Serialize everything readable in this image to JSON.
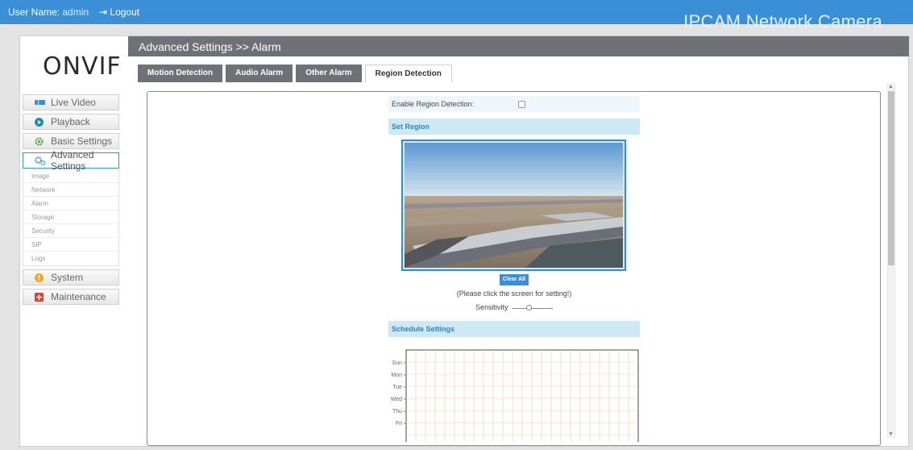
{
  "topbar": {
    "user_label": "User Name:",
    "user_value": "admin",
    "logout": "Logout",
    "brand": "IPCAM Network Camera"
  },
  "sidebar": {
    "logo": "ONVIF",
    "items": [
      {
        "label": "Live Video",
        "icon": "live-video-icon"
      },
      {
        "label": "Playback",
        "icon": "playback-icon"
      },
      {
        "label": "Basic Settings",
        "icon": "gear-icon"
      },
      {
        "label": "Advanced Settings",
        "icon": "gears-icon"
      },
      {
        "label": "System",
        "icon": "info-icon"
      },
      {
        "label": "Maintenance",
        "icon": "plus-icon"
      }
    ],
    "submenu": [
      "Image",
      "Network",
      "Alarm",
      "Storage",
      "Security",
      "SIP",
      "Logs"
    ]
  },
  "breadcrumb": "Advanced Settings >> Alarm",
  "tabs": [
    "Motion Detection",
    "Audio Alarm",
    "Other Alarm",
    "Region Detection"
  ],
  "active_tab": "Region Detection",
  "form": {
    "enable_label": "Enable Region Detection:",
    "enable_checked": false,
    "set_region_title": "Set Region",
    "clear_all": "Clear All",
    "hint": "(Please click the screen for setting!)",
    "sensitivity_label": "Sensitivity",
    "sensitivity_value": 0.4,
    "schedule_title": "Schedule Settings",
    "schedule_days": [
      "Sun",
      "Mon",
      "Tue",
      "Wed",
      "Thu",
      "Fri"
    ]
  },
  "colors": {
    "accent": "#3a8fd6",
    "titlebar": "#6e7276",
    "section_bg": "#cfe8f5",
    "schedule_grid": "#f2c9a0"
  }
}
